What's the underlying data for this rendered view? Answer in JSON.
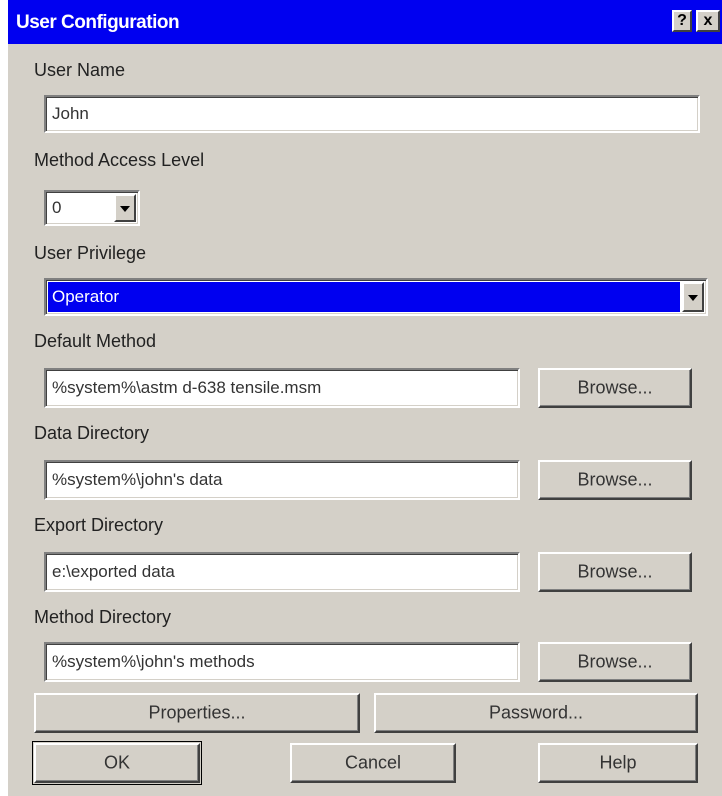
{
  "window": {
    "title": "User Configuration",
    "help_glyph": "?",
    "close_glyph": "x",
    "title_color": "#0000f0"
  },
  "user_name": {
    "label": "User Name",
    "value": "John"
  },
  "method_access_level": {
    "label": "Method Access Level",
    "value": "0"
  },
  "user_privilege": {
    "label": "User Privilege",
    "value": "Operator",
    "highlight_color": "#0000f0"
  },
  "default_method": {
    "label": "Default Method",
    "value": "%system%\\astm d-638 tensile.msm",
    "browse_label": "Browse..."
  },
  "data_directory": {
    "label": "Data Directory",
    "value": "%system%\\john's data",
    "browse_label": "Browse..."
  },
  "export_directory": {
    "label": "Export Directory",
    "value": "e:\\exported data",
    "browse_label": "Browse..."
  },
  "method_directory": {
    "label": "Method Directory",
    "value": "%system%\\john's methods",
    "browse_label": "Browse..."
  },
  "buttons": {
    "properties": "Properties...",
    "password": "Password...",
    "ok": "OK",
    "cancel": "Cancel",
    "help": "Help"
  }
}
